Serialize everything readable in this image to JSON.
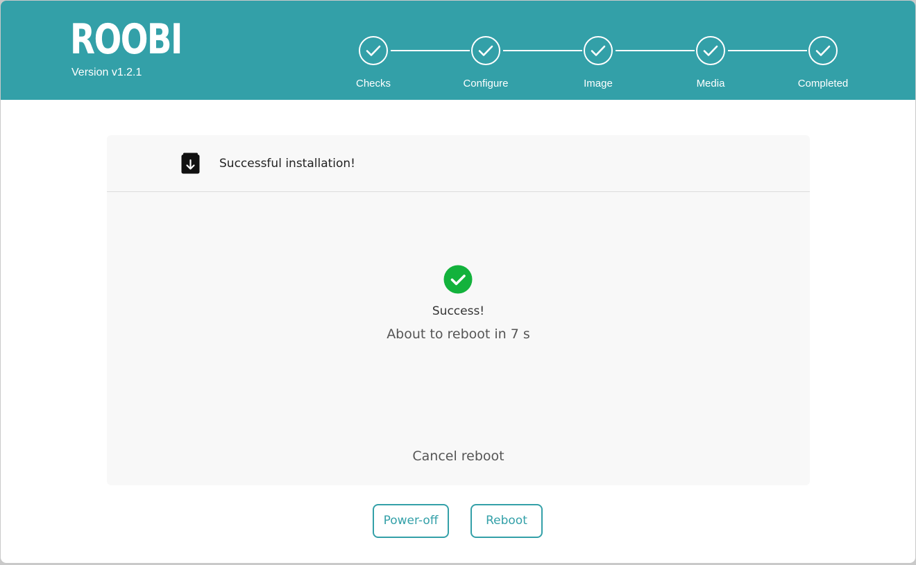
{
  "app": {
    "logo": "ROOBI",
    "version": "Version v1.2.1"
  },
  "stepper": {
    "steps": [
      {
        "label": "Checks",
        "status": "completed"
      },
      {
        "label": "Configure",
        "status": "completed"
      },
      {
        "label": "Image",
        "status": "completed"
      },
      {
        "label": "Media",
        "status": "completed"
      },
      {
        "label": "Completed",
        "status": "completed"
      }
    ]
  },
  "card": {
    "title": "Successful installation!",
    "header_icon": "download-box-icon",
    "status_icon": "check-circle-icon",
    "status_title": "Success!",
    "countdown": "About to reboot in 7 s",
    "cancel_label": "Cancel reboot"
  },
  "actions": {
    "power_off_label": "Power-off",
    "reboot_label": "Reboot"
  },
  "colors": {
    "accent": "#33a0a8",
    "success": "#13b23c"
  }
}
